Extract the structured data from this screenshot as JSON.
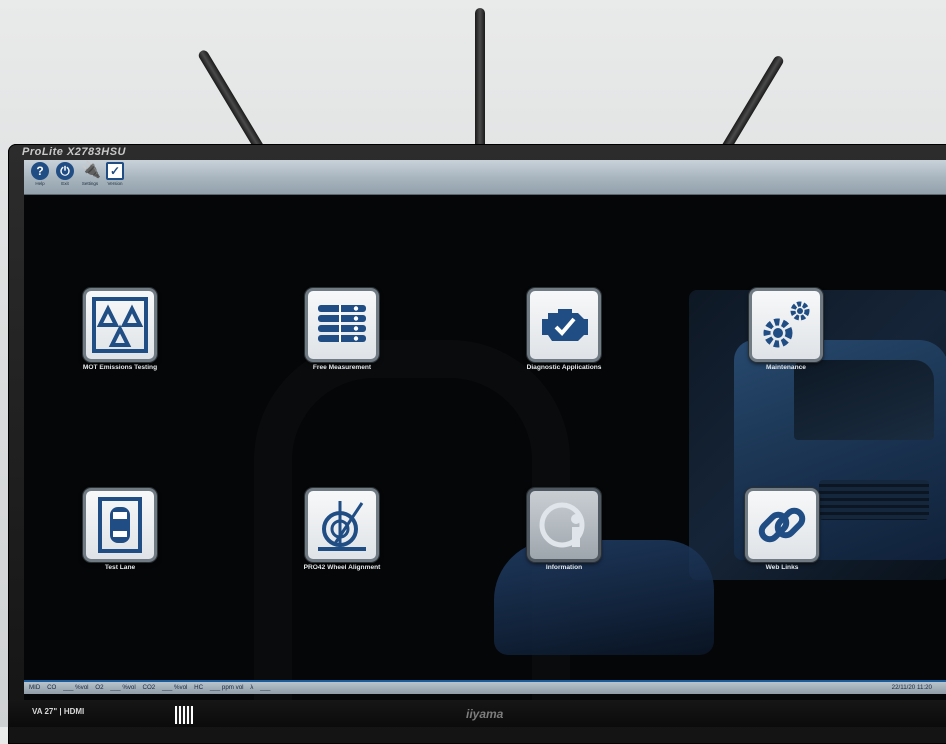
{
  "monitor": {
    "model": "ProLite X2783HSU",
    "bezel_info": "VA  27\" | HDMI",
    "brand": "iiyama"
  },
  "toolbar": {
    "buttons": [
      {
        "label": "Help",
        "icon": "help-icon"
      },
      {
        "label": "Exit",
        "icon": "power-icon"
      },
      {
        "label": "Settings",
        "icon": "plug-icon"
      },
      {
        "label": "Version",
        "icon": "checkbox-icon"
      }
    ]
  },
  "tiles": [
    {
      "label": "MOT Emissions Testing",
      "icon": "mot-triangles-icon"
    },
    {
      "label": "Free Measurement",
      "icon": "list-toggles-icon"
    },
    {
      "label": "Diagnostic Applications",
      "icon": "engine-check-icon"
    },
    {
      "label": "Maintenance",
      "icon": "gears-icon"
    },
    {
      "label": "Test Lane",
      "icon": "car-topview-icon"
    },
    {
      "label": "PRO42 Wheel Alignment",
      "icon": "wheel-alignment-icon"
    },
    {
      "label": "Information",
      "icon": "info-icon"
    },
    {
      "label": "Web Links",
      "icon": "chain-link-icon"
    }
  ],
  "status": {
    "mid": "MID",
    "co": "CO",
    "co_val": "___ %vol",
    "o2": "O2",
    "o2_val": "___ %vol",
    "co2": "CO2",
    "co2_val": "___ %vol",
    "hc": "HC",
    "hc_val": "___ ppm vol",
    "lambda": "λ",
    "lambda_val": "___",
    "datetime": "22/11/20   11:20"
  },
  "colors": {
    "accent": "#1f4d84",
    "status_border": "#1b5c9c"
  }
}
